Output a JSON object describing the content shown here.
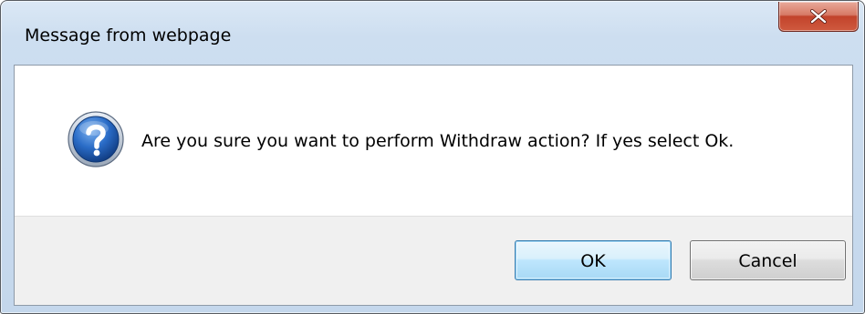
{
  "window": {
    "title": "Message from webpage"
  },
  "titlebar": {
    "close_icon": "close-icon",
    "close_glyph": "x"
  },
  "message": {
    "icon": "question-icon",
    "text": "Are you sure you want to perform Withdraw action? If yes select Ok."
  },
  "buttons": {
    "ok_label": "OK",
    "cancel_label": "Cancel"
  },
  "colors": {
    "close_button": "#c2432b",
    "icon_blue": "#1f5fb4",
    "default_button_border": "#3c7fb1"
  }
}
